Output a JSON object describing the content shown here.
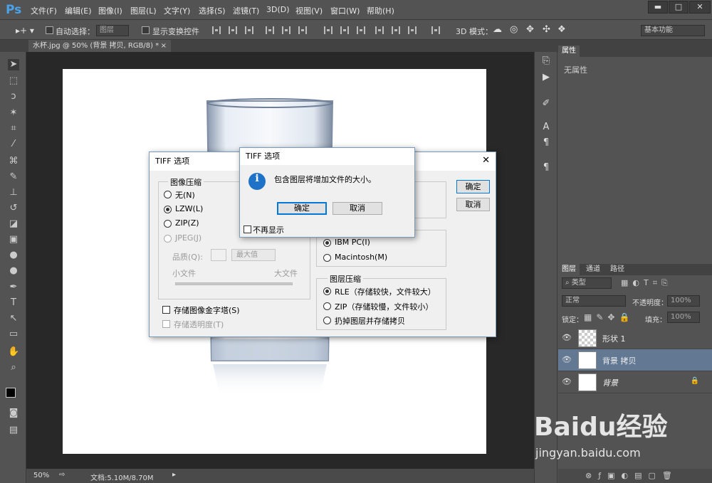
{
  "app": {
    "logo": "Ps"
  },
  "menu": [
    "文件(F)",
    "编辑(E)",
    "图像(I)",
    "图层(L)",
    "文字(Y)",
    "选择(S)",
    "滤镜(T)",
    "3D(D)",
    "视图(V)",
    "窗口(W)",
    "帮助(H)"
  ],
  "window_buttons": {
    "minimize": "▬",
    "restore": "□",
    "close": "✕"
  },
  "options": {
    "auto_select_label": "自动选择：",
    "auto_select_value": "图层",
    "show_transform_label": "显示变换控件",
    "mode_3d_label": "3D 模式：",
    "workspace": "基本功能"
  },
  "document_tab": {
    "title": "水杯.jpg @ 50% (背景 拷贝, RGB/8) *",
    "close": "×"
  },
  "status": {
    "zoom": "50%",
    "doc_info": "文档:5.10M/8.70M"
  },
  "properties": {
    "tab": "属性",
    "empty": "无属性"
  },
  "layers_panel": {
    "tabs": [
      "图层",
      "通道",
      "路径"
    ],
    "kind_filter": "类型",
    "blend_mode": "正常",
    "opacity_label": "不透明度：",
    "opacity": "100%",
    "lock_label": "锁定：",
    "fill_label": "填充：",
    "fill": "100%",
    "layers": [
      {
        "name": "形状 1",
        "selected": false
      },
      {
        "name": "背景 拷贝",
        "selected": true
      },
      {
        "name": "背景",
        "selected": false
      }
    ]
  },
  "tiff_dialog": {
    "title": "TIFF 选项",
    "close": "✕",
    "compression_group": "图像压缩",
    "options": [
      "无(N)",
      "LZW(L)",
      "ZIP(Z)",
      "JPEG(J)"
    ],
    "quality_label": "品质(Q):",
    "quality_value": "最大值",
    "small_file": "小文件",
    "large_file": "大文件",
    "save_pyramid": "存储图像金字塔(S)",
    "save_transparency": "存储透明度(T)",
    "byte_order": [
      "IBM PC(I)",
      "Macintosh(M)"
    ],
    "layer_compression_group": "图层压缩",
    "layer_compression": [
      "RLE（存储较快，文件较大）",
      "ZIP（存储较慢，文件较小）",
      "扔掉图层并存储拷贝"
    ],
    "ok": "确定",
    "cancel": "取消"
  },
  "info_dialog": {
    "title": "TIFF 选项",
    "message": "包含图层将增加文件的大小。",
    "icon": "i",
    "ok": "确定",
    "cancel": "取消",
    "dont_show": "不再显示"
  },
  "watermark": {
    "brand": "Baidu经验",
    "url": "jingyan.baidu.com"
  },
  "colors": {
    "accent": "#4aa3e8",
    "selected_layer": "#627893",
    "dialog_bg": "#f0f0f0",
    "info_icon": "#1e72c8"
  }
}
